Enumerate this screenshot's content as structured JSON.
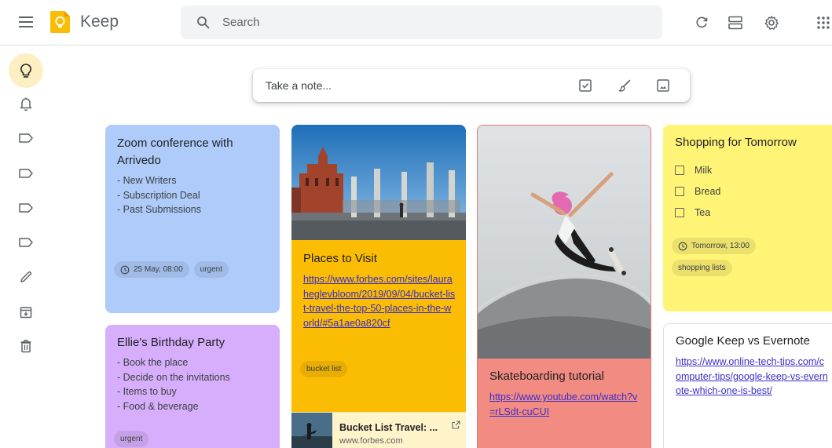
{
  "header": {
    "app_name": "Keep",
    "search_placeholder": "Search"
  },
  "take_note": {
    "placeholder": "Take a note..."
  },
  "notes": {
    "zoom": {
      "title": "Zoom conference with Arrivedo",
      "items": [
        "- New Writers",
        "- Subscription Deal",
        "- Past Submissions"
      ],
      "reminder": "25 May, 08:00",
      "label": "urgent",
      "color": "#aecbfa"
    },
    "birthday": {
      "title": "Ellie's Birthday Party",
      "items": [
        "- Book the place",
        "- Decide on the invitations",
        "- Items to buy",
        "- Food & beverage"
      ],
      "label": "urgent",
      "color": "#d7aefb"
    },
    "places": {
      "title": "Places to Visit",
      "link": "https://www.forbes.com/sites/lauraheglevbloom/2019/09/04/bucket-list-travel-the-top-50-places-in-the-world/#5a1ae0a820cf",
      "label": "bucket list",
      "preview_title": "Bucket List Travel: ...",
      "preview_domain": "www.forbes.com",
      "color": "#fbbc04"
    },
    "skate": {
      "title": "Skateboarding tutorial",
      "link": "https://www.youtube.com/watch?v=rLSdt-cuCUI",
      "color": "#f28b82"
    },
    "shopping": {
      "title": "Shopping for Tomorrow",
      "items": [
        "Milk",
        "Bread",
        "Tea"
      ],
      "reminder": "Tomorrow, 13:00",
      "label": "shopping lists",
      "color": "#fff475"
    },
    "keep_vs": {
      "title": "Google Keep vs Evernote",
      "link": "https://www.online-tech-tips.com/computer-tips/google-keep-vs-evernote-which-one-is-best/",
      "color": "#e8eaed"
    }
  },
  "colors": {
    "accent_active": "#feefc3",
    "link": "#3a2ec9",
    "logo": "#fbbc04"
  }
}
